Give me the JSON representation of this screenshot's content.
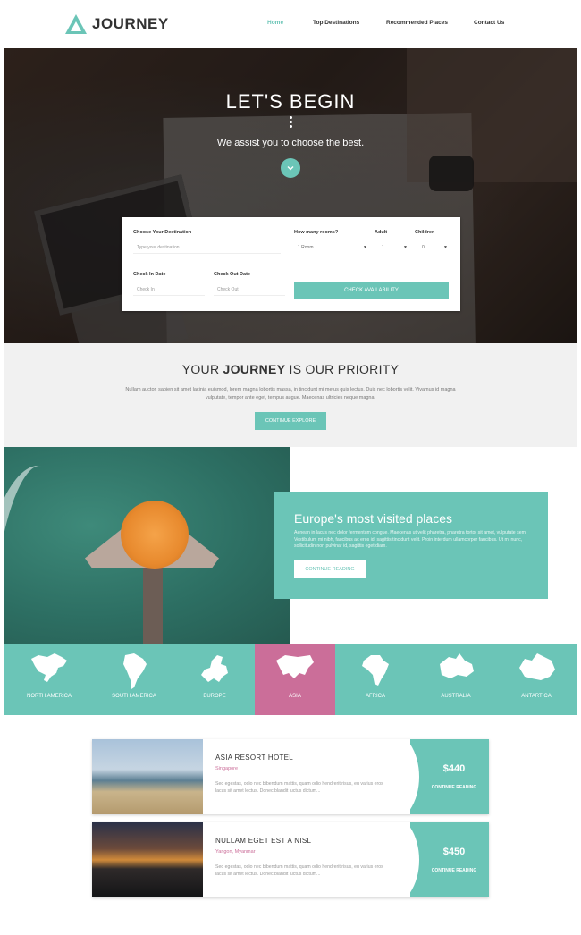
{
  "header": {
    "logo_text": "JOURNEY",
    "nav": [
      "Home",
      "Top Destinations",
      "Recommended Places",
      "Contact Us"
    ],
    "active_nav": "Home"
  },
  "hero": {
    "title": "LET'S BEGIN",
    "subtitle": "We assist you to choose the best."
  },
  "booking": {
    "destination_label": "Choose Your Destination",
    "destination_placeholder": "Type your destination...",
    "rooms_label": "How many rooms?",
    "rooms_value": "1 Room",
    "adult_label": "Adult",
    "adult_value": "1",
    "children_label": "Children",
    "children_value": "0",
    "checkin_label": "Check In Date",
    "checkin_placeholder": "Check In",
    "checkout_label": "Check Out Date",
    "checkout_placeholder": "Check Out",
    "submit_label": "CHECK AVAILABILITY"
  },
  "priority": {
    "title_before": "YOUR ",
    "title_bold": "JOURNEY",
    "title_after": " IS OUR PRIORITY",
    "text": "Nullam auctor, sapien sit amet lacinia euismod, lorem magna lobortis massa, in tincidunt mi metus quis lectus. Duis nec lobortis velit. Vivamus id magna vulputate, tempor ante eget, tempus augue. Maecenas ultricies neque magna.",
    "button": "CONTINUE EXPLORE"
  },
  "europe": {
    "title": "Europe's most visited places",
    "text": "Aenean in lacus nec dolor fermentum congue. Maecenas ut velit pharetra, pharetra tortor sit amet, vulputate sem. Vestibulum mi nibh, faucibus ac eros id, sagittis tincidunt velit. Proin interdum ullamcorper faucibus. Ut mi nunc, sollicitudin non pulvinar id, sagittis eget diam.",
    "button": "CONTINUE READING"
  },
  "continents": [
    {
      "name": "NORTH AMERICA",
      "icon": "north-america-map-icon"
    },
    {
      "name": "SOUTH AMERICA",
      "icon": "south-america-map-icon"
    },
    {
      "name": "EUROPE",
      "icon": "europe-map-icon"
    },
    {
      "name": "ASIA",
      "icon": "asia-map-icon",
      "active": true
    },
    {
      "name": "AFRICA",
      "icon": "africa-map-icon"
    },
    {
      "name": "AUSTRALIA",
      "icon": "australia-map-icon"
    },
    {
      "name": "ANTARTICA",
      "icon": "antarctica-map-icon"
    }
  ],
  "hotels": [
    {
      "name": "ASIA RESORT HOTEL",
      "location": "Singapore",
      "desc": "Sed egestas, odio nec bibendum mattis, quam odio hendrerit risus, eu varius eros lacus sit amet lectus. Donec blandit luctus dictum...",
      "price": "$440",
      "more": "CONTINUE READING"
    },
    {
      "name": "NULLAM EGET EST A NISL",
      "location": "Yangon, Myanmar",
      "desc": "Sed egestas, odio nec bibendum mattis, quam odio hendrerit risus, eu varius eros lacus sit amet lectus. Donec blandit luctus dictum...",
      "price": "$450",
      "more": "CONTINUE READING"
    }
  ],
  "colors": {
    "accent": "#6bc5b7",
    "highlight": "#cb6e99",
    "text": "#333333"
  }
}
